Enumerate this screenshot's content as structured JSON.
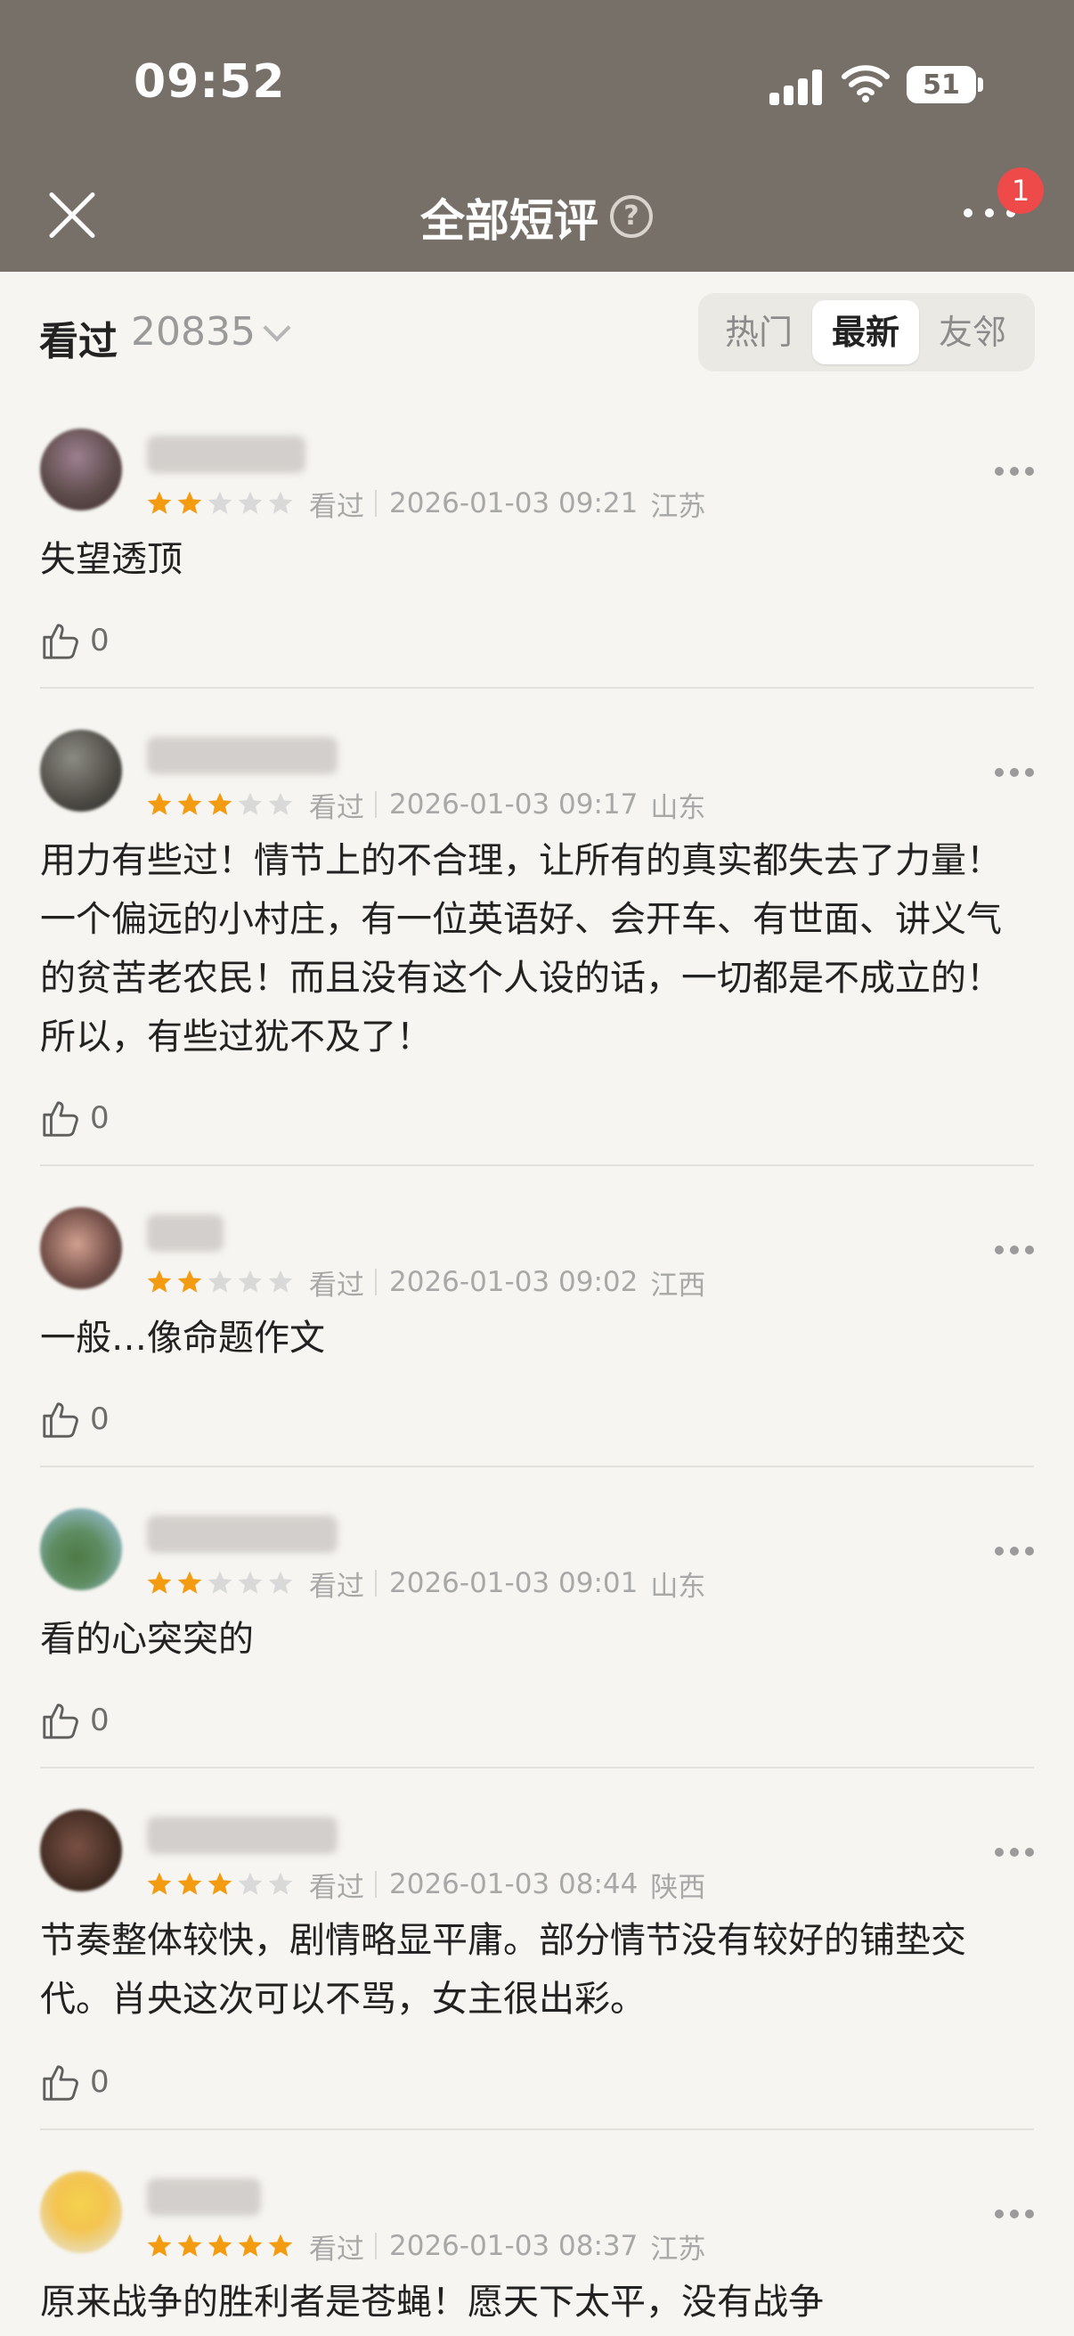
{
  "status": {
    "time": "09:52",
    "battery": "51"
  },
  "nav": {
    "title": "全部短评",
    "badge": "1"
  },
  "filter": {
    "label": "看过",
    "count": "20835",
    "tabs": [
      "热门",
      "最新",
      "友邻"
    ],
    "active_tab": "最新"
  },
  "colors": {
    "accent": "#f39c12",
    "topbar": "#777068",
    "background": "#f6f5f1",
    "badge": "#ef4a4a"
  },
  "reviews": [
    {
      "rating": 2,
      "status": "看过",
      "time": "2026-01-03 09:21",
      "location": "江苏",
      "text": "失望透顶",
      "likes": "0"
    },
    {
      "rating": 3,
      "status": "看过",
      "time": "2026-01-03 09:17",
      "location": "山东",
      "text": "用力有些过！情节上的不合理，让所有的真实都失去了力量！一个偏远的小村庄，有一位英语好、会开车、有世面、讲义气的贫苦老农民！而且没有这个人设的话，一切都是不成立的！所以，有些过犹不及了！",
      "likes": "0"
    },
    {
      "rating": 2,
      "status": "看过",
      "time": "2026-01-03 09:02",
      "location": "江西",
      "text": "一般…像命题作文",
      "likes": "0"
    },
    {
      "rating": 2,
      "status": "看过",
      "time": "2026-01-03 09:01",
      "location": "山东",
      "text": "看的心突突的",
      "likes": "0"
    },
    {
      "rating": 3,
      "status": "看过",
      "time": "2026-01-03 08:44",
      "location": "陕西",
      "text": "节奏整体较快，剧情略显平庸。部分情节没有较好的铺垫交代。肖央这次可以不骂，女主很出彩。",
      "likes": "0"
    },
    {
      "rating": 5,
      "status": "看过",
      "time": "2026-01-03 08:37",
      "location": "江苏",
      "text": "原来战争的胜利者是苍蝇！愿天下太平，没有战争",
      "likes": ""
    }
  ]
}
